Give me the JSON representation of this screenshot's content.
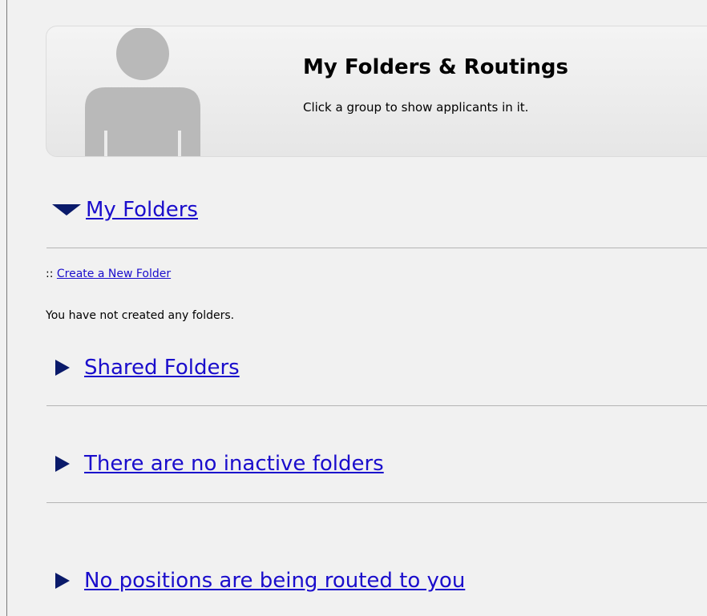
{
  "header": {
    "title": "My Folders & Routings",
    "subtitle": "Click a group to show applicants in it."
  },
  "my_folders": {
    "label": "My Folders",
    "expanded": true,
    "create_prefix": "::",
    "create_link": "Create a New Folder",
    "empty_message": "You have not created any folders."
  },
  "shared_folders": {
    "label": "Shared Folders",
    "expanded": false
  },
  "inactive_folders": {
    "label": "There are no inactive folders",
    "expanded": false
  },
  "routings": {
    "label": "No positions are being routed to you",
    "expanded": false
  },
  "colors": {
    "link": "#1a0dcc",
    "triangle": "#0a1a6a",
    "background": "#f1f1f1",
    "avatar": "#b9b9b9"
  },
  "icons": {
    "avatar": "person-silhouette-icon",
    "expanded": "triangle-down-icon",
    "collapsed": "triangle-right-icon"
  }
}
